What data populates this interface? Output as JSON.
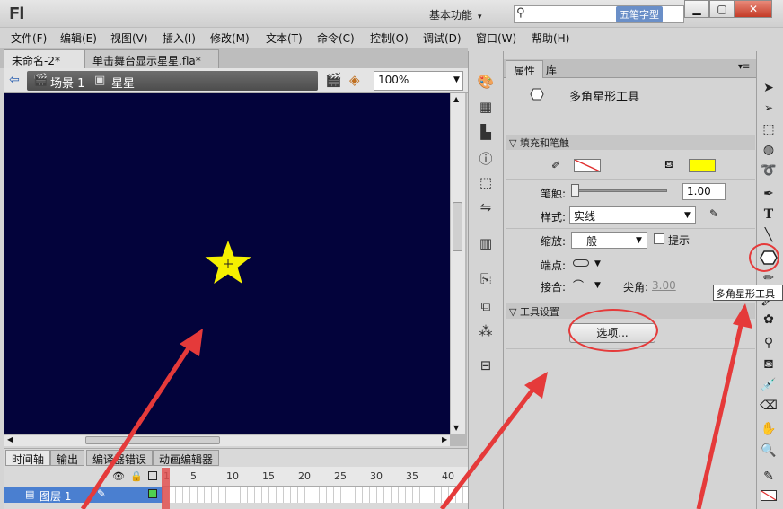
{
  "app": {
    "logo": "Fl",
    "workspace": "基本功能",
    "search_placeholder": "",
    "watermark": "五笔字型"
  },
  "menu": [
    "文件(F)",
    "编辑(E)",
    "视图(V)",
    "插入(I)",
    "修改(M)",
    "文本(T)",
    "命令(C)",
    "控制(O)",
    "调试(D)",
    "窗口(W)",
    "帮助(H)"
  ],
  "doc_tabs": [
    {
      "label": "未命名-2*",
      "close": "×"
    },
    {
      "label": "单击舞台显示星星.fla*",
      "close": "×"
    }
  ],
  "editbar": {
    "scene": "场景 1",
    "symbol": "星星",
    "zoom": "100%"
  },
  "timeline": {
    "tabs": [
      "时间轴",
      "输出",
      "编译器错误",
      "动画编辑器"
    ],
    "frame_numbers": [
      "1",
      "5",
      "10",
      "15",
      "20",
      "25",
      "30",
      "35",
      "40"
    ],
    "layer": "图层 1"
  },
  "props": {
    "tabs": [
      "属性",
      "库"
    ],
    "tool_name": "多角星形工具",
    "section_fill": "填充和笔触",
    "stroke_label": "笔触:",
    "stroke_value": "1.00",
    "style_label": "样式:",
    "style_value": "实线",
    "scale_label": "缩放:",
    "scale_value": "一般",
    "hint_label": "提示",
    "cap_label": "端点:",
    "join_label": "接合:",
    "miter_label": "尖角:",
    "miter_value": "3.00",
    "section_tool": "工具设置",
    "options_button": "选项..."
  },
  "tooltip": "多角星形工具",
  "colors": {
    "stage": "#03033b",
    "star": "#f5f000",
    "fill_swatch": "#ffff00",
    "annotation": "#e53a3a"
  }
}
